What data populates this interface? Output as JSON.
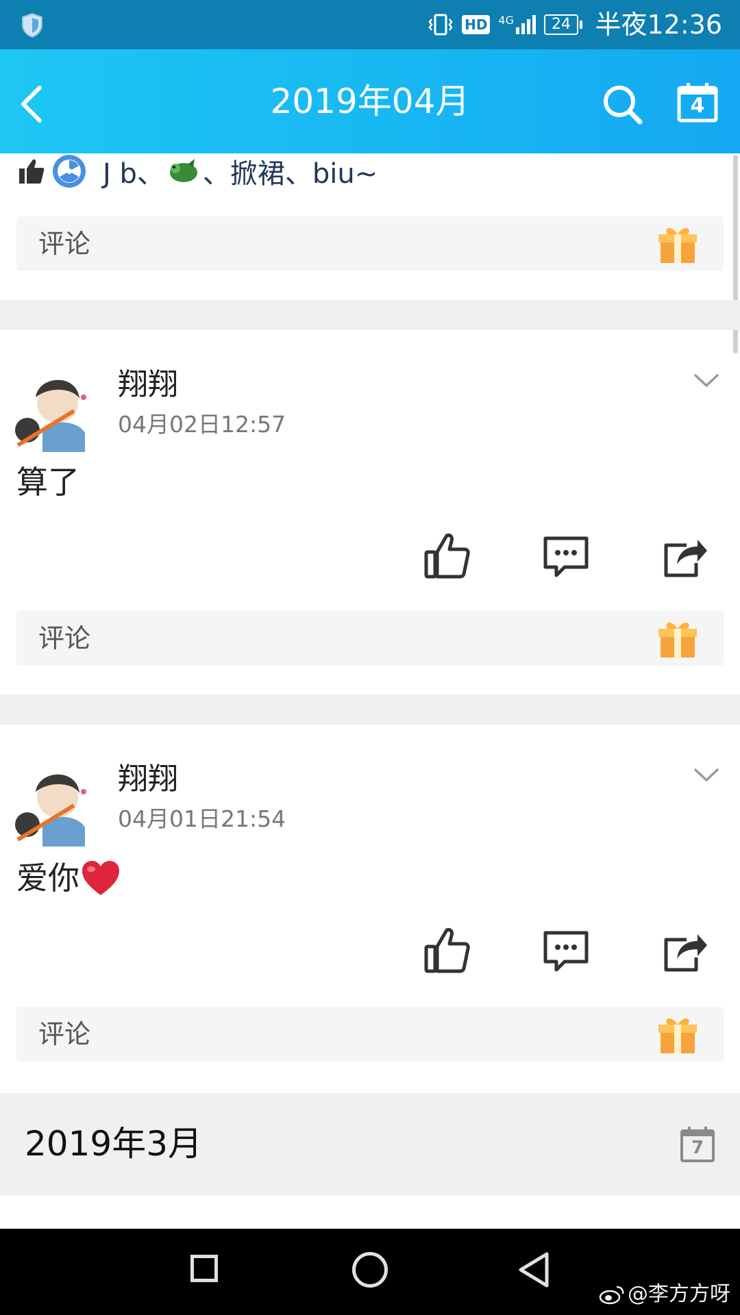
{
  "status_bar": {
    "hd": "HD",
    "signal_label": "4G",
    "battery": "24",
    "time": "半夜12:36"
  },
  "header": {
    "title": "2019年04月"
  },
  "likes": {
    "names": "J b、",
    "names_rest": "、掀裙、biu~"
  },
  "comment_label": "评论",
  "posts": [
    {
      "username": "翔翔",
      "time": "04月02日12:57",
      "content": "算了"
    },
    {
      "username": "翔翔",
      "time": "04月01日21:54",
      "content": "爱你"
    }
  ],
  "calendar_icon_day": "4",
  "month_section": {
    "label": "2019年3月",
    "calendar_day": "7"
  },
  "watermark": "@李方方呀",
  "colors": {
    "header_start": "#1dc7f3",
    "header_end": "#14a9f2",
    "status_bar": "#0d7fb0",
    "like_names": "#24365a",
    "heart": "#e0243a"
  }
}
